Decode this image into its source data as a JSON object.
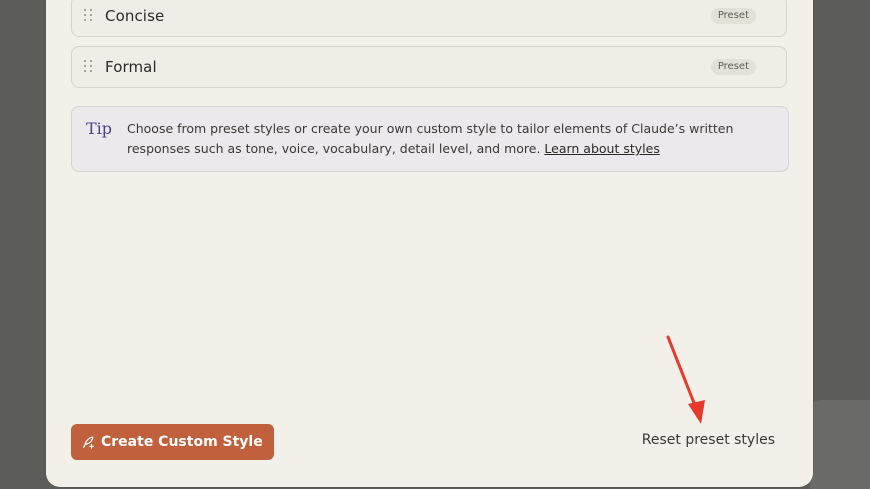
{
  "styles_list": [
    {
      "name": "Concise",
      "badge": "Preset"
    },
    {
      "name": "Formal",
      "badge": "Preset"
    }
  ],
  "tip": {
    "label": "Tip",
    "text": "Choose from preset styles or create your own custom style to tailor elements of Claude’s written responses such as tone, voice, vocabulary, detail level, and more. ",
    "link_text": "Learn about styles"
  },
  "footer": {
    "create_label": "Create Custom Style",
    "reset_label": "Reset preset styles"
  },
  "colors": {
    "accent": "#c0603c",
    "tip_label": "#4b3e8c",
    "annotation_arrow": "#e8392d"
  },
  "icons": {
    "drag_handle": "drag-handle-icon",
    "create_style": "quill-plus-icon"
  }
}
